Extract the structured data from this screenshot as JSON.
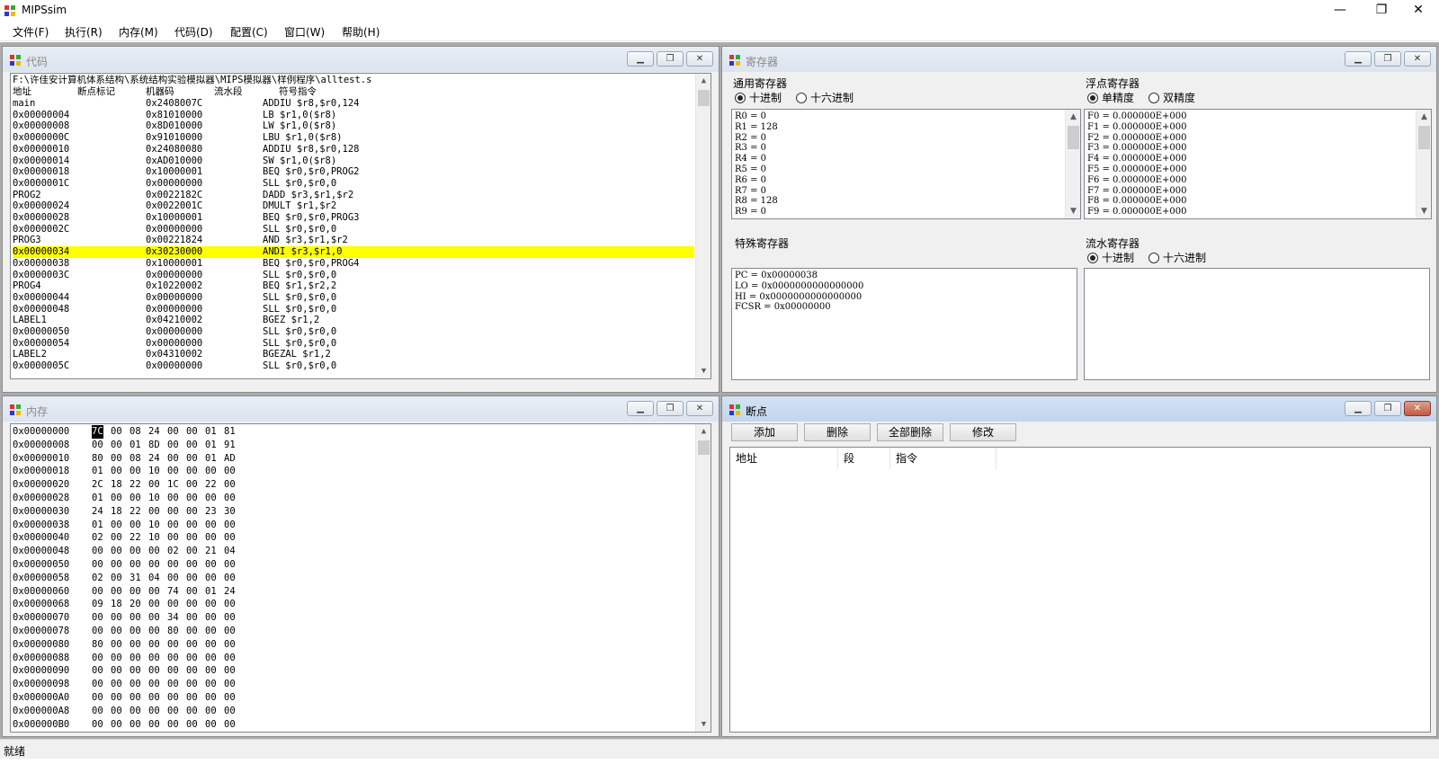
{
  "window": {
    "title": "MIPSsim",
    "minimize": "—",
    "maximize": "❐",
    "close": "✕"
  },
  "menu": [
    "文件(F)",
    "执行(R)",
    "内存(M)",
    "代码(D)",
    "配置(C)",
    "窗口(W)",
    "帮助(H)"
  ],
  "code_window": {
    "title": "代码",
    "path": "F:\\许佳安计算机体系结构\\系统结构实验模拟器\\MIPS模拟器\\样例程序\\alltest.s",
    "headers": [
      "地址",
      "断点标记",
      "机器码",
      "流水段",
      "符号指令"
    ],
    "rows": [
      {
        "addr": "main",
        "code": "0x2408007C",
        "inst": "ADDIU $r8,$r0,124"
      },
      {
        "addr": "0x00000004",
        "code": "0x81010000",
        "inst": "LB $r1,0($r8)"
      },
      {
        "addr": "0x00000008",
        "code": "0x8D010000",
        "inst": "LW $r1,0($r8)"
      },
      {
        "addr": "0x0000000C",
        "code": "0x91010000",
        "inst": "LBU $r1,0($r8)"
      },
      {
        "addr": "0x00000010",
        "code": "0x24080080",
        "inst": "ADDIU $r8,$r0,128"
      },
      {
        "addr": "0x00000014",
        "code": "0xAD010000",
        "inst": "SW $r1,0($r8)"
      },
      {
        "addr": "0x00000018",
        "code": "0x10000001",
        "inst": "BEQ $r0,$r0,PROG2"
      },
      {
        "addr": "0x0000001C",
        "code": "0x00000000",
        "inst": "SLL $r0,$r0,0"
      },
      {
        "addr": "PROG2",
        "code": "0x0022182C",
        "inst": "DADD $r3,$r1,$r2"
      },
      {
        "addr": "0x00000024",
        "code": "0x0022001C",
        "inst": "DMULT $r1,$r2"
      },
      {
        "addr": "0x00000028",
        "code": "0x10000001",
        "inst": "BEQ $r0,$r0,PROG3"
      },
      {
        "addr": "0x0000002C",
        "code": "0x00000000",
        "inst": "SLL $r0,$r0,0"
      },
      {
        "addr": "PROG3",
        "code": "0x00221824",
        "inst": "AND $r3,$r1,$r2"
      },
      {
        "addr": "0x00000034",
        "code": "0x30230000",
        "inst": "ANDI $r3,$r1,0",
        "highlight": true
      },
      {
        "addr": "0x00000038",
        "code": "0x10000001",
        "inst": "BEQ $r0,$r0,PROG4"
      },
      {
        "addr": "0x0000003C",
        "code": "0x00000000",
        "inst": "SLL $r0,$r0,0"
      },
      {
        "addr": "PROG4",
        "code": "0x10220002",
        "inst": "BEQ $r1,$r2,2"
      },
      {
        "addr": "0x00000044",
        "code": "0x00000000",
        "inst": "SLL $r0,$r0,0"
      },
      {
        "addr": "0x00000048",
        "code": "0x00000000",
        "inst": "SLL $r0,$r0,0"
      },
      {
        "addr": "LABEL1",
        "code": "0x04210002",
        "inst": "BGEZ $r1,2"
      },
      {
        "addr": "0x00000050",
        "code": "0x00000000",
        "inst": "SLL $r0,$r0,0"
      },
      {
        "addr": "0x00000054",
        "code": "0x00000000",
        "inst": "SLL $r0,$r0,0"
      },
      {
        "addr": "LABEL2",
        "code": "0x04310002",
        "inst": "BGEZAL $r1,2"
      },
      {
        "addr": "0x0000005C",
        "code": "0x00000000",
        "inst": "SLL $r0,$r0,0"
      }
    ]
  },
  "memory_window": {
    "title": "内存",
    "rows": [
      {
        "addr": "0x00000000",
        "bytes": [
          "7C",
          "00",
          "08",
          "24",
          "00",
          "00",
          "01",
          "81"
        ]
      },
      {
        "addr": "0x00000008",
        "bytes": [
          "00",
          "00",
          "01",
          "8D",
          "00",
          "00",
          "01",
          "91"
        ]
      },
      {
        "addr": "0x00000010",
        "bytes": [
          "80",
          "00",
          "08",
          "24",
          "00",
          "00",
          "01",
          "AD"
        ]
      },
      {
        "addr": "0x00000018",
        "bytes": [
          "01",
          "00",
          "00",
          "10",
          "00",
          "00",
          "00",
          "00"
        ]
      },
      {
        "addr": "0x00000020",
        "bytes": [
          "2C",
          "18",
          "22",
          "00",
          "1C",
          "00",
          "22",
          "00"
        ]
      },
      {
        "addr": "0x00000028",
        "bytes": [
          "01",
          "00",
          "00",
          "10",
          "00",
          "00",
          "00",
          "00"
        ]
      },
      {
        "addr": "0x00000030",
        "bytes": [
          "24",
          "18",
          "22",
          "00",
          "00",
          "00",
          "23",
          "30"
        ]
      },
      {
        "addr": "0x00000038",
        "bytes": [
          "01",
          "00",
          "00",
          "10",
          "00",
          "00",
          "00",
          "00"
        ]
      },
      {
        "addr": "0x00000040",
        "bytes": [
          "02",
          "00",
          "22",
          "10",
          "00",
          "00",
          "00",
          "00"
        ]
      },
      {
        "addr": "0x00000048",
        "bytes": [
          "00",
          "00",
          "00",
          "00",
          "02",
          "00",
          "21",
          "04"
        ]
      },
      {
        "addr": "0x00000050",
        "bytes": [
          "00",
          "00",
          "00",
          "00",
          "00",
          "00",
          "00",
          "00"
        ]
      },
      {
        "addr": "0x00000058",
        "bytes": [
          "02",
          "00",
          "31",
          "04",
          "00",
          "00",
          "00",
          "00"
        ]
      },
      {
        "addr": "0x00000060",
        "bytes": [
          "00",
          "00",
          "00",
          "00",
          "74",
          "00",
          "01",
          "24"
        ]
      },
      {
        "addr": "0x00000068",
        "bytes": [
          "09",
          "18",
          "20",
          "00",
          "00",
          "00",
          "00",
          "00"
        ]
      },
      {
        "addr": "0x00000070",
        "bytes": [
          "00",
          "00",
          "00",
          "00",
          "34",
          "00",
          "00",
          "00"
        ]
      },
      {
        "addr": "0x00000078",
        "bytes": [
          "00",
          "00",
          "00",
          "00",
          "80",
          "00",
          "00",
          "00"
        ]
      },
      {
        "addr": "0x00000080",
        "bytes": [
          "80",
          "00",
          "00",
          "00",
          "00",
          "00",
          "00",
          "00"
        ]
      },
      {
        "addr": "0x00000088",
        "bytes": [
          "00",
          "00",
          "00",
          "00",
          "00",
          "00",
          "00",
          "00"
        ]
      },
      {
        "addr": "0x00000090",
        "bytes": [
          "00",
          "00",
          "00",
          "00",
          "00",
          "00",
          "00",
          "00"
        ]
      },
      {
        "addr": "0x00000098",
        "bytes": [
          "00",
          "00",
          "00",
          "00",
          "00",
          "00",
          "00",
          "00"
        ]
      },
      {
        "addr": "0x000000A0",
        "bytes": [
          "00",
          "00",
          "00",
          "00",
          "00",
          "00",
          "00",
          "00"
        ]
      },
      {
        "addr": "0x000000A8",
        "bytes": [
          "00",
          "00",
          "00",
          "00",
          "00",
          "00",
          "00",
          "00"
        ]
      },
      {
        "addr": "0x000000B0",
        "bytes": [
          "00",
          "00",
          "00",
          "00",
          "00",
          "00",
          "00",
          "00"
        ]
      }
    ]
  },
  "register_window": {
    "title": "寄存器",
    "general": {
      "label": "通用寄存器",
      "radio": [
        {
          "label": "十进制",
          "checked": true
        },
        {
          "label": "十六进制",
          "checked": false
        }
      ],
      "rows": [
        "R0 = 0",
        "R1 = 128",
        "R2 = 0",
        "R3 = 0",
        "R4 = 0",
        "R5 = 0",
        "R6 = 0",
        "R7 = 0",
        "R8 = 128",
        "R9 = 0"
      ]
    },
    "float": {
      "label": "浮点寄存器",
      "radio": [
        {
          "label": "单精度",
          "checked": true
        },
        {
          "label": "双精度",
          "checked": false
        }
      ],
      "rows": [
        "F0 = 0.000000E+000",
        "F1 = 0.000000E+000",
        "F2 = 0.000000E+000",
        "F3 = 0.000000E+000",
        "F4 = 0.000000E+000",
        "F5 = 0.000000E+000",
        "F6 = 0.000000E+000",
        "F7 = 0.000000E+000",
        "F8 = 0.000000E+000",
        "F9 = 0.000000E+000"
      ]
    },
    "special": {
      "label": "特殊寄存器",
      "rows": [
        "PC = 0x00000038",
        "LO = 0x0000000000000000",
        "HI = 0x0000000000000000",
        "FCSR = 0x00000000"
      ]
    },
    "pipeline": {
      "label": "流水寄存器",
      "radio": [
        {
          "label": "十进制",
          "checked": true
        },
        {
          "label": "十六进制",
          "checked": false
        }
      ]
    }
  },
  "breakpoint_window": {
    "title": "断点",
    "buttons": [
      "添加",
      "删除",
      "全部删除",
      "修改"
    ],
    "columns": [
      "地址",
      "段",
      "指令"
    ]
  },
  "status": "就绪",
  "colors": {
    "highlight": "#ffff00",
    "mdi_background": "#ababab"
  }
}
